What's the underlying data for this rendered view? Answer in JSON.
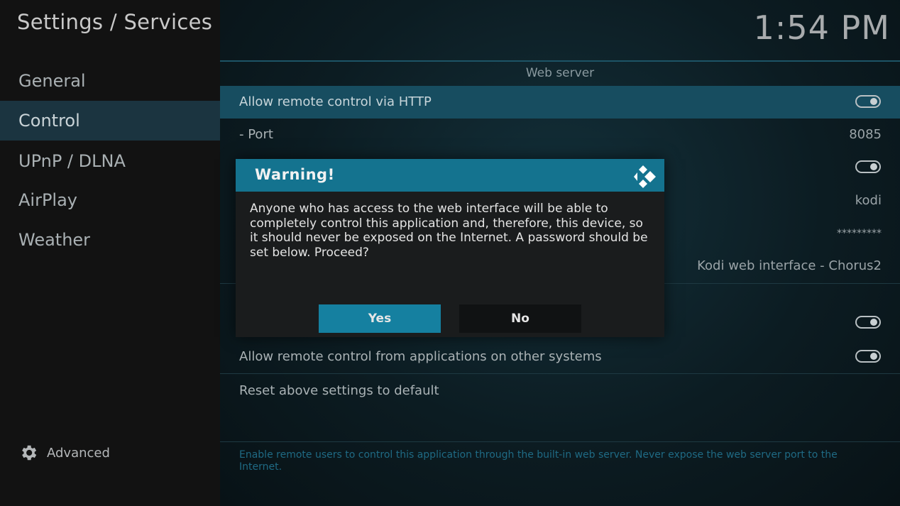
{
  "header": {
    "title": "Settings / Services",
    "clock": "1:54 PM"
  },
  "sidebar": {
    "items": [
      {
        "label": "General",
        "active": false
      },
      {
        "label": "Control",
        "active": true
      },
      {
        "label": "UPnP / DLNA",
        "active": false
      },
      {
        "label": "AirPlay",
        "active": false
      },
      {
        "label": "Weather",
        "active": false
      }
    ],
    "advanced_label": "Advanced",
    "advanced_icon": "gear-icon"
  },
  "main": {
    "section_title": "Web server",
    "rows": [
      {
        "label": "Allow remote control via HTTP",
        "type": "toggle",
        "value": true,
        "focused": true
      },
      {
        "label": "- Port",
        "type": "value",
        "value": "8085"
      },
      {
        "label": "",
        "type": "toggle",
        "value": true
      },
      {
        "label": "",
        "type": "value",
        "value": "kodi"
      },
      {
        "label": "",
        "type": "value",
        "value": "*********"
      },
      {
        "label": "",
        "type": "value",
        "value": "Kodi web interface - Chorus2"
      },
      {
        "label": "",
        "type": "toggle",
        "value": true
      },
      {
        "label": "Allow remote control from applications on other systems",
        "type": "toggle",
        "value": true
      },
      {
        "label": "Reset above settings to default",
        "type": "action"
      }
    ],
    "hint": "Enable remote users to control this application through the built-in web server. Never expose the web server port to the Internet."
  },
  "dialog": {
    "title": "Warning!",
    "logo_icon": "kodi-logo-icon",
    "message": "Anyone who has access to the web interface will be able to completely control this application and, therefore, this device, so it should never be exposed on the Internet. A password should be set below. Proceed?",
    "yes_label": "Yes",
    "no_label": "No"
  },
  "colors": {
    "accent": "#14738f",
    "focused_row": "#174d60",
    "active_nav": "#1b3440",
    "hint_text": "#1f6a84"
  }
}
